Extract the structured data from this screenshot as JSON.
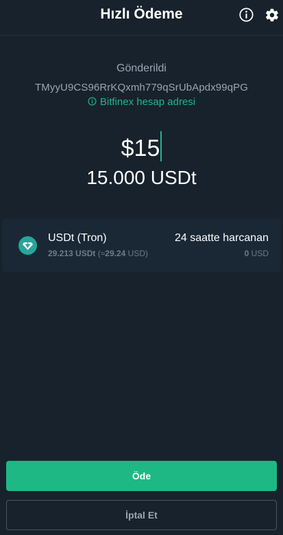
{
  "header": {
    "title": "Hızlı Ödeme",
    "info_icon": "info-icon",
    "settings_icon": "gear-icon"
  },
  "recipient": {
    "status_label": "Gönderildi",
    "address": "TMyyU9CS96RrKQxmh779qSrUbApdx99qPG",
    "address_note": "Bitfinex hesap adresi",
    "note_icon": "info-circle-icon"
  },
  "amount": {
    "fiat": "$15",
    "crypto": "15.000 USDt"
  },
  "asset": {
    "icon": "tron-diamond-icon",
    "name": "USDt (Tron)",
    "balance_amount": "29.213 USDt",
    "balance_fiat_prefix": " (≈",
    "balance_fiat_value": "29.24",
    "balance_fiat_suffix": " USD)",
    "spent_label": "24 saatte harcanan",
    "spent_value": "0",
    "spent_unit": " USD"
  },
  "actions": {
    "pay_label": "Öde",
    "cancel_label": "İptal Et"
  },
  "colors": {
    "background": "#17222d",
    "accent": "#1db883",
    "muted_text": "#9aa6b2",
    "tron_icon": "#26a69a"
  }
}
